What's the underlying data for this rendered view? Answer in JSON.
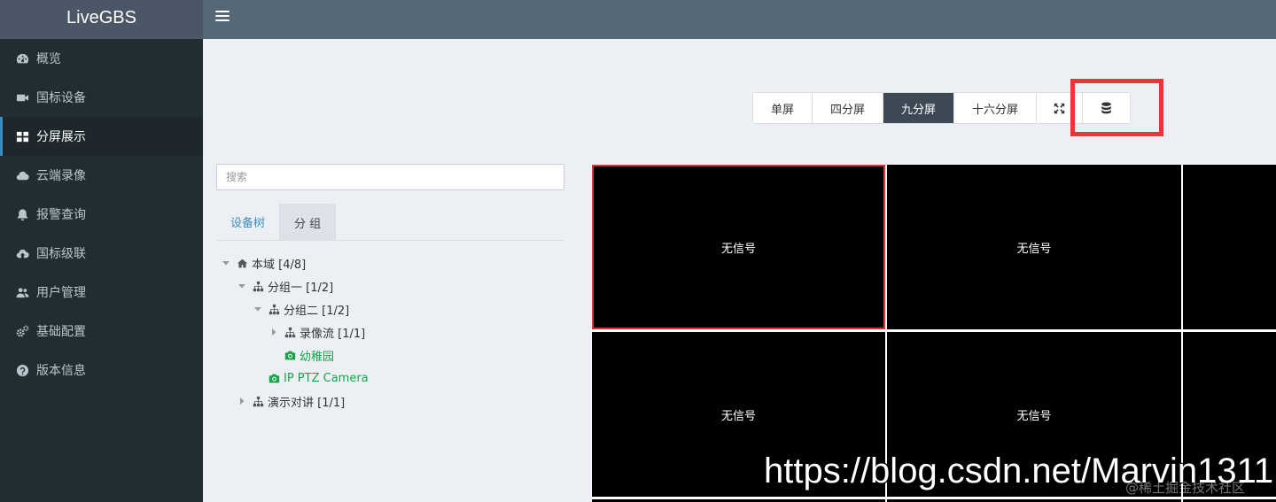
{
  "app": {
    "brand": "LiveGBS"
  },
  "sidebar": {
    "items": [
      {
        "label": "概览",
        "icon": "dashboard-icon",
        "active": false
      },
      {
        "label": "国标设备",
        "icon": "video-camera-icon",
        "active": false
      },
      {
        "label": "分屏展示",
        "icon": "grid-icon",
        "active": true
      },
      {
        "label": "云端录像",
        "icon": "cloud-icon",
        "active": false
      },
      {
        "label": "报警查询",
        "icon": "bell-icon",
        "active": false
      },
      {
        "label": "国标级联",
        "icon": "cloud-upload-icon",
        "active": false
      },
      {
        "label": "用户管理",
        "icon": "users-icon",
        "active": false
      },
      {
        "label": "基础配置",
        "icon": "gears-icon",
        "active": false
      },
      {
        "label": "版本信息",
        "icon": "info-icon",
        "active": false
      }
    ]
  },
  "toolbar": {
    "buttons": [
      {
        "label": "单屏",
        "active": false
      },
      {
        "label": "四分屏",
        "active": false
      },
      {
        "label": "九分屏",
        "active": true
      },
      {
        "label": "十六分屏",
        "active": false
      }
    ],
    "fullscreen_icon": "fullscreen-icon",
    "storage_icon": "database-icon"
  },
  "search": {
    "placeholder": "搜索"
  },
  "tabs": [
    {
      "label": "设备树",
      "active": false
    },
    {
      "label": "分 组",
      "active": true
    }
  ],
  "tree": [
    {
      "label": "本域 [4/8]",
      "depth": 0,
      "caret": "down",
      "icon": "home-icon",
      "color": "#333333"
    },
    {
      "label": "分组一 [1/2]",
      "depth": 1,
      "caret": "down",
      "icon": "sitemap-icon",
      "color": "#333333"
    },
    {
      "label": "分组二 [1/2]",
      "depth": 2,
      "caret": "down",
      "icon": "sitemap-icon",
      "color": "#333333"
    },
    {
      "label": "录像流 [1/1]",
      "depth": 3,
      "caret": "right",
      "icon": "sitemap-icon",
      "color": "#333333"
    },
    {
      "label": "幼稚园",
      "depth": 3,
      "caret": "none",
      "icon": "camera-icon",
      "color": "#1aa34a"
    },
    {
      "label": "IP PTZ Camera",
      "depth": 2,
      "caret": "none",
      "icon": "camera-icon",
      "color": "#1aa34a"
    },
    {
      "label": "演示对讲 [1/1]",
      "depth": 1,
      "caret": "right",
      "icon": "sitemap-icon",
      "color": "#333333"
    }
  ],
  "grid": {
    "cells": [
      {
        "label": "无信号",
        "selected": true
      },
      {
        "label": "无信号",
        "selected": false
      },
      {
        "label": "",
        "selected": false
      },
      {
        "label": "无信号",
        "selected": false
      },
      {
        "label": "无信号",
        "selected": false
      },
      {
        "label": "",
        "selected": false
      }
    ]
  },
  "watermark": {
    "url": "https://blog.csdn.net/Marvin1311",
    "community": "@稀土掘金技术社区"
  },
  "colors": {
    "sidebar": "#222d32",
    "topbar": "#566778",
    "active_button": "#3d4a56",
    "highlight": "#e8363a",
    "online": "#1aa34a"
  }
}
